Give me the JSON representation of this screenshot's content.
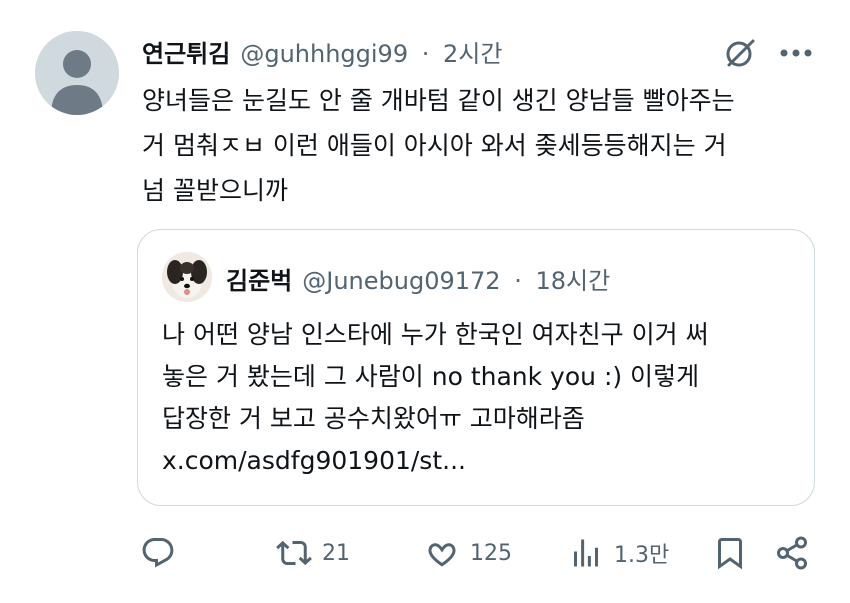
{
  "tweet": {
    "author_name": "연근튀김",
    "handle": "@guhhhggi99",
    "separator": "·",
    "time": "2시간",
    "avatar_icon": "default-avatar-icon",
    "text_lines": [
      "양녀들은 눈길도 안 줄 개바텀 같이 생긴 양남들 빨아주는",
      "거 멈춰ㅈㅂ 이런 애들이 아시아 와서 좆세등등해지는 거",
      "넘 꼴받으니까"
    ]
  },
  "quoted": {
    "author_name": "김준벅",
    "handle": "@Junebug09172",
    "separator": "·",
    "time": "18시간",
    "avatar_icon": "dog-photo-avatar",
    "text_lines": [
      "나 어떤 양남 인스타에 누가 한국인 여자친구 이거 써",
      "놓은 거 봤는데 그 사람이 no thank you :) 이렇게",
      "답장한 거 보고 공수치왔어ㅠ 고마해라좀",
      "x.com/asdfg901901/st..."
    ]
  },
  "actions": {
    "reply": {
      "icon": "reply-icon",
      "count": ""
    },
    "retweet": {
      "icon": "retweet-icon",
      "count": "21"
    },
    "like": {
      "icon": "heart-icon",
      "count": "125"
    },
    "views": {
      "icon": "views-icon",
      "count": "1.3만"
    },
    "bookmark": {
      "icon": "bookmark-icon"
    },
    "share": {
      "icon": "share-icon"
    }
  },
  "colors": {
    "text": "#0f1419",
    "secondary": "#536471",
    "border": "#cfd9de"
  }
}
